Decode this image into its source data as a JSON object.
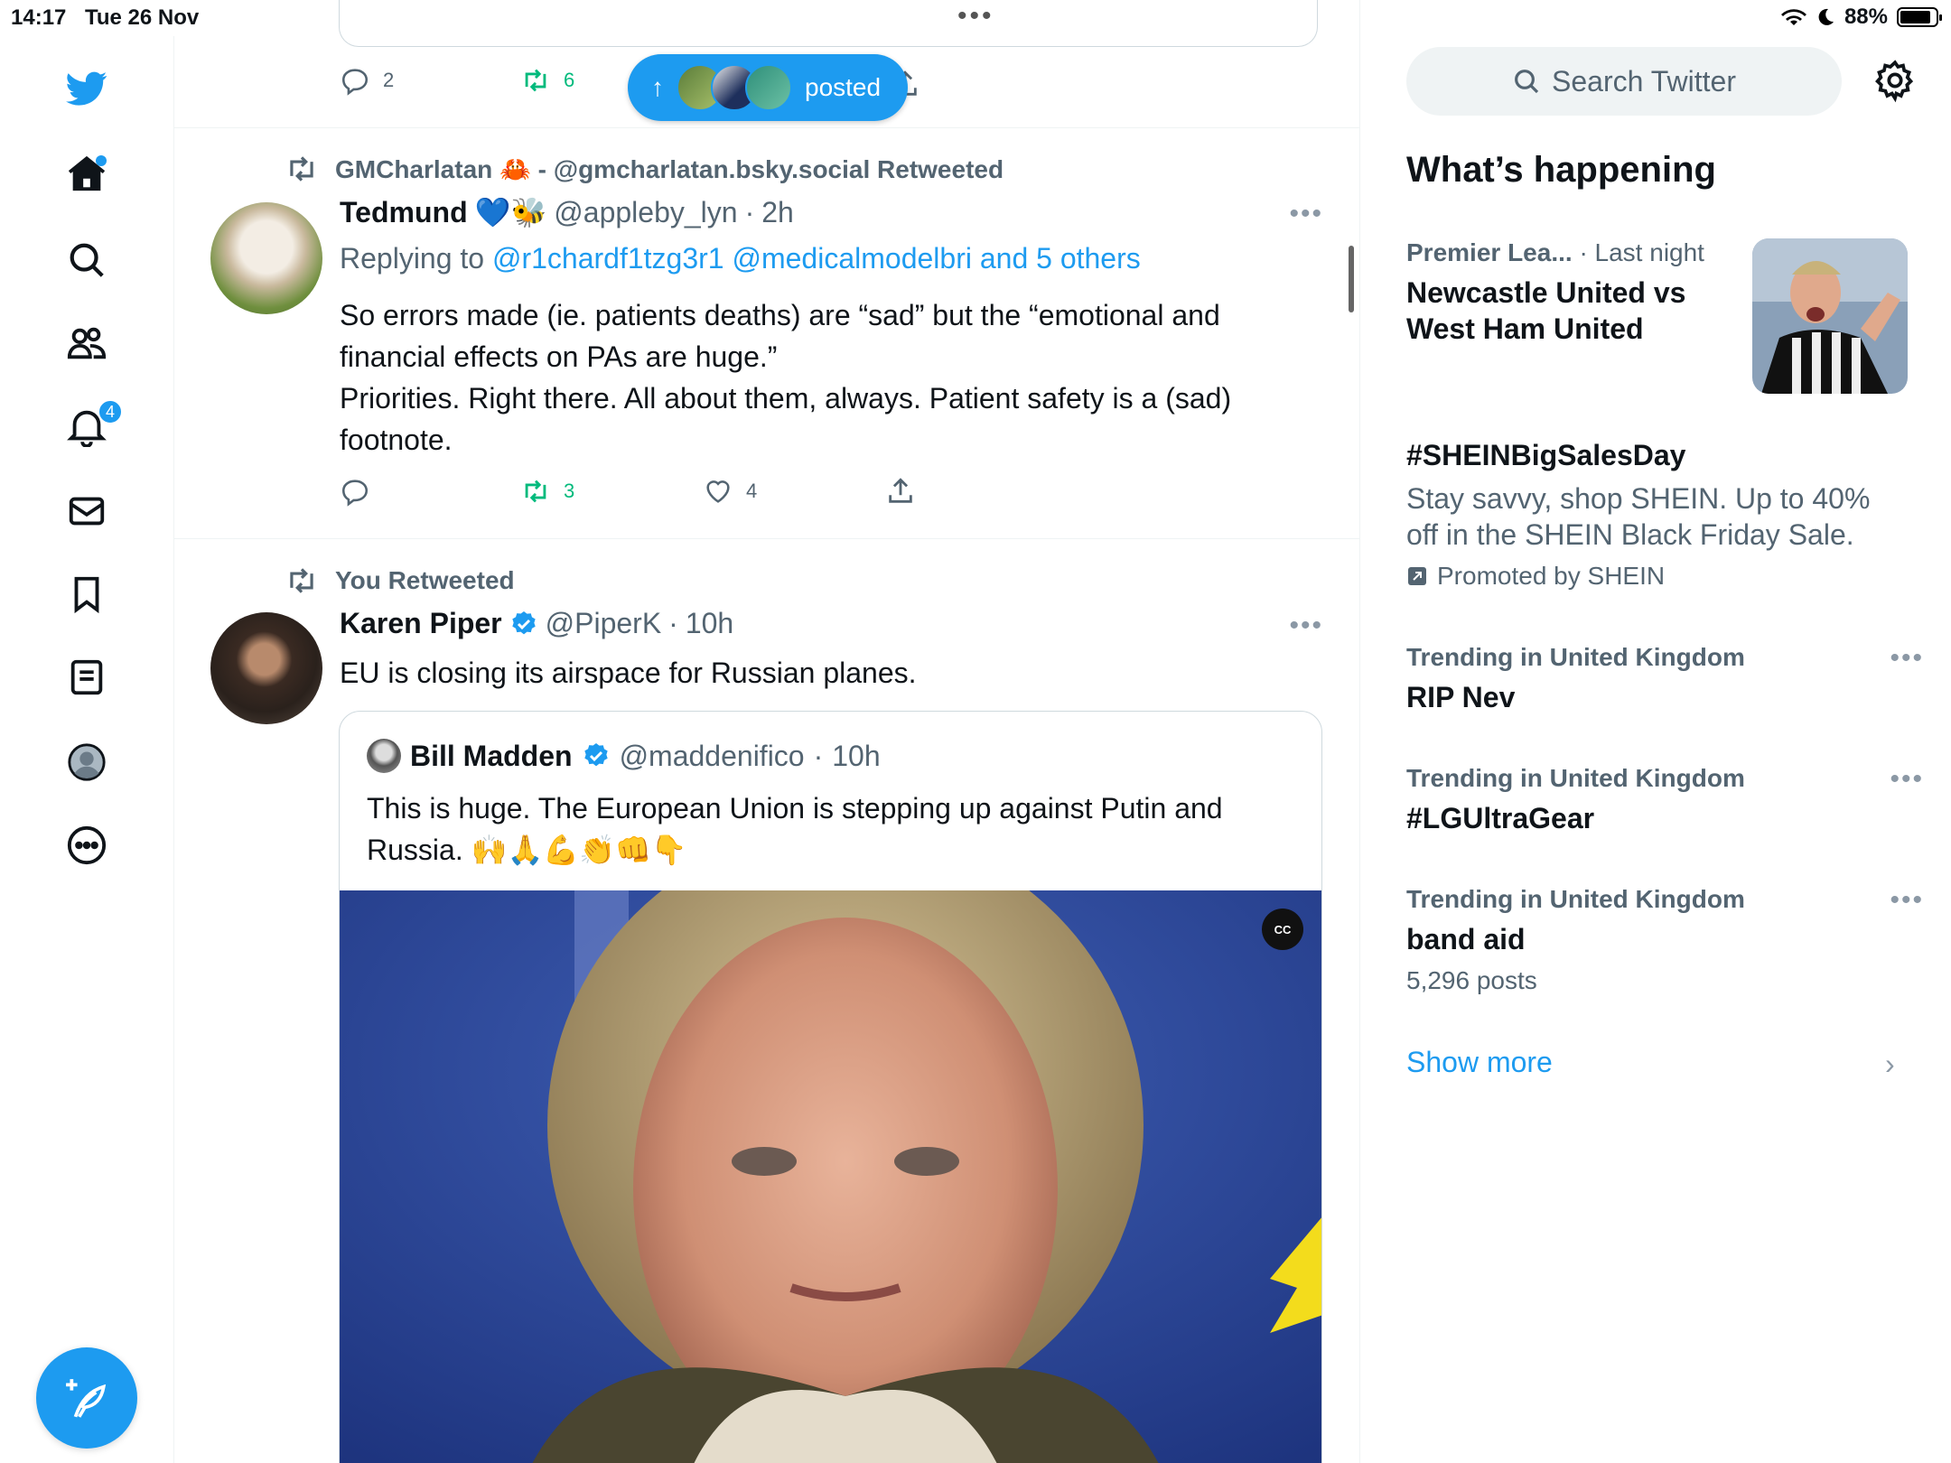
{
  "status_bar": {
    "time": "14:17",
    "date": "Tue 26 Nov",
    "battery": "88%",
    "battery_level": 0.88
  },
  "nav": {
    "notifications_badge": "4",
    "compose_label": "Post"
  },
  "previous_tweet": {
    "reply_count": "2",
    "retweet_count": "6"
  },
  "posted_pill": {
    "label": "posted"
  },
  "tweets": [
    {
      "retweeted_by": "GMCharlatan 🦀 - @gmcharlatan.bsky.social Retweeted",
      "name": "Tedmund",
      "name_emoji": "💙🐝",
      "handle": "@appleby_lyn",
      "time": "2h",
      "replying_prefix": "Replying to",
      "replying_to": "@r1chardf1tzg3r1 @medicalmodelbri and 5 others",
      "text_lines": [
        "So errors made (ie. patients deaths) are “sad” but the “emotional and",
        "financial effects on PAs are huge.”",
        "Priorities. Right there. All about them, always. Patient safety is a (sad)",
        "footnote."
      ],
      "retweet_count": "3",
      "like_count": "4"
    },
    {
      "retweeted_by": "You Retweeted",
      "name": "Karen Piper",
      "handle": "@PiperK",
      "time": "10h",
      "text": "EU is closing its airspace for Russian planes.",
      "quote": {
        "name": "Bill Madden",
        "handle": "@maddenifico",
        "time": "10h",
        "text_lines": [
          "This is huge. The European Union is stepping up against Putin and",
          "Russia. 🙌🙏💪👏👊👇"
        ],
        "cc_label": "CC"
      }
    }
  ],
  "sidebar": {
    "search_placeholder": "Search Twitter",
    "whats_happening": "What’s happening",
    "trends": [
      {
        "meta": "Premier Lea...",
        "meta_time": "· Last night",
        "topic_lines": [
          "Newcastle United vs",
          "West Ham United"
        ]
      },
      {
        "topic": "#SHEINBigSalesDay",
        "desc_lines": [
          "Stay savvy, shop SHEIN. Up to 40%",
          "off in the SHEIN Black Friday Sale."
        ],
        "promo": "Promoted by SHEIN"
      },
      {
        "meta": "Trending in United Kingdom",
        "topic": "RIP Nev"
      },
      {
        "meta": "Trending in United Kingdom",
        "topic": "#LGUltraGear"
      },
      {
        "meta": "Trending in United Kingdom",
        "topic": "band aid",
        "posts": "5,296 posts"
      }
    ],
    "show_more": "Show more"
  },
  "colors": {
    "accent": "#1d9bf0",
    "retweet_green": "#00ba7c",
    "secondary_text": "#536471"
  }
}
